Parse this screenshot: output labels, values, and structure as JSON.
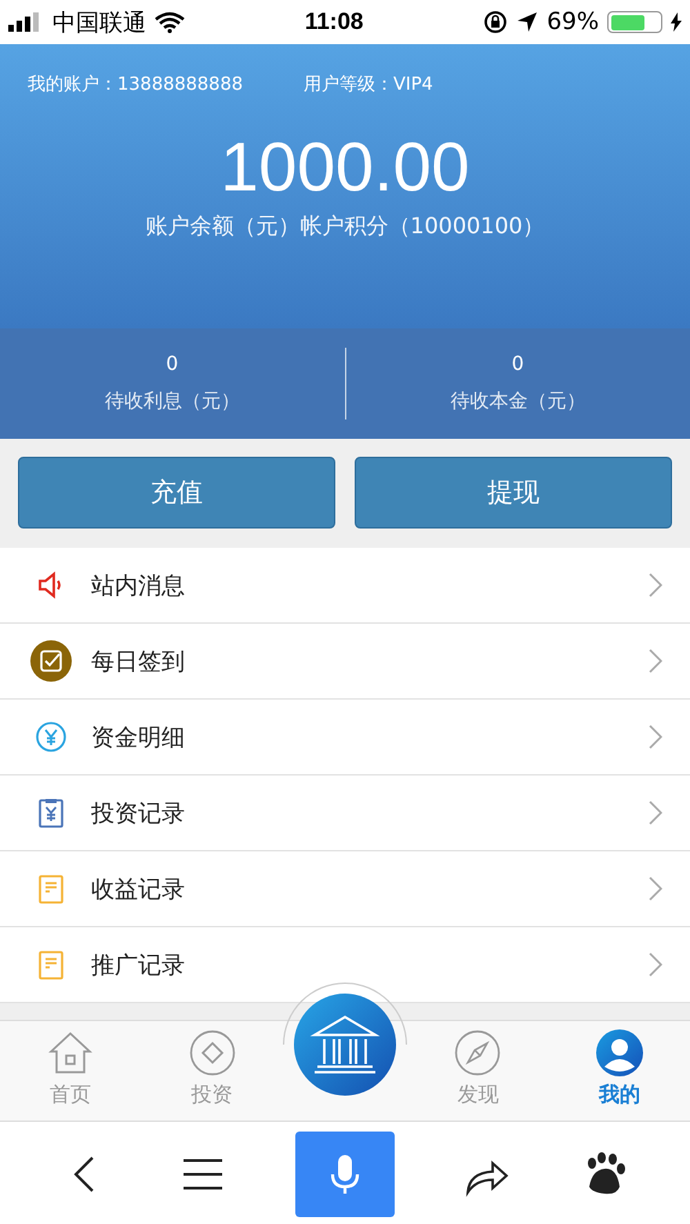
{
  "status_bar": {
    "carrier": "中国联通",
    "time": "11:08",
    "battery_percent": "69%",
    "battery": {
      "level": 0.69
    }
  },
  "header": {
    "account": "我的账户：13888888888",
    "level_label": "用户等级：VIP4",
    "balance": "1000.00",
    "caption": "账户余额（元）帐户积分（10000100）"
  },
  "stats": [
    {
      "value": "0",
      "label": "待收利息（元）"
    },
    {
      "value": "0",
      "label": "待收本金（元）"
    }
  ],
  "actions": [
    "充值",
    "提现"
  ],
  "menu": [
    {
      "kind": "speaker",
      "label": "站内消息"
    },
    {
      "kind": "checkin",
      "label": "每日签到"
    },
    {
      "kind": "yen",
      "label": "资金明细"
    },
    {
      "kind": "clipboard",
      "label": "投资记录"
    },
    {
      "kind": "doc",
      "label": "收益记录"
    },
    {
      "kind": "doc",
      "label": "推广记录"
    }
  ],
  "tab_bar": [
    {
      "kind": "home",
      "label": "首页",
      "selected": false
    },
    {
      "kind": "diamond",
      "label": "投资",
      "selected": false
    },
    {
      "kind": "bank"
    },
    {
      "kind": "compass",
      "label": "发现",
      "selected": false
    },
    {
      "kind": "user",
      "label": "我的",
      "selected": true
    }
  ]
}
